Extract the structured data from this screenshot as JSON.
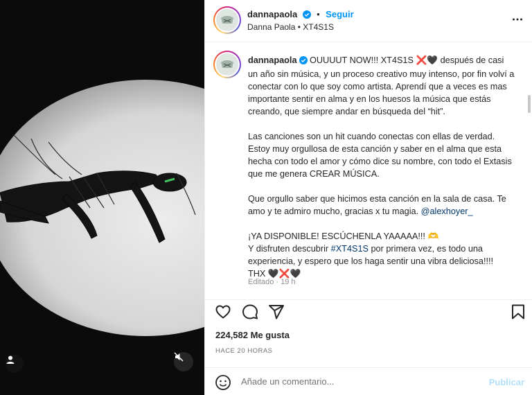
{
  "post": {
    "username": "dannapaola",
    "follow_label": "Seguir",
    "dot": "•",
    "subline": "Danna Paola • XT4S1S",
    "caption": {
      "username": "dannapaola",
      "p1": " OUUUUT NOW!!! XT4S1S ❌🖤 después de casi un año sin música, y un proceso creativo muy intenso, por fin volví a conectar con lo que soy como artista. Aprendí que a veces es mas importante sentir en alma y en los huesos la música que estás creando, que siempre andar en búsqueda del “hit”.",
      "p2": "Las canciones son un hit cuando conectas con ellas de verdad. Estoy muy orgullosa de esta canción y saber en el alma que esta hecha con todo el amor y cómo dice su nombre, con todo el Extasis que me genera CREAR MÚSICA.",
      "p3_text": "Que orgullo saber que hicimos esta canción en la sala de casa. Te amo y te admiro mucho, gracias x tu magia. ",
      "p3_mention": "@alexhoyer_",
      "p4_line1": "¡YA DISPONIBLE! ESCÚCHENLA YAAAAA!!! 🫶",
      "p4_line2_start": "Y disfruten descubrir ",
      "p4_hashtag": "#XT4S1S",
      "p4_line2_end": " por primera vez, es todo una experiencia, y espero que los haga sentir una vibra deliciosa!!!!",
      "p4_line3": "THX 🖤❌🖤"
    },
    "edited": "Editado · 19 h",
    "likes": "224,582 Me gusta",
    "time": "HACE 20 HORAS",
    "comment_placeholder": "Añade un comentario...",
    "publish_label": "Publicar"
  },
  "icons": {
    "more": "more-options-icon",
    "verified": "verified-badge-icon",
    "like": "heart-icon",
    "comment": "comment-icon",
    "share": "send-icon",
    "save": "bookmark-icon",
    "emoji": "emoji-icon",
    "tag": "user-tag-icon",
    "mute": "muted-speaker-icon"
  },
  "colors": {
    "link": "#0095f6",
    "mention": "#00376b",
    "publish_disabled": "#b2dffc"
  }
}
